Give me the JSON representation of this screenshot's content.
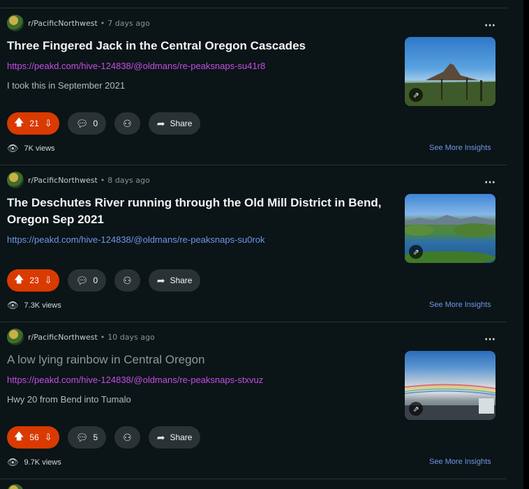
{
  "posts": [
    {
      "subreddit": "r/PacificNorthwest",
      "time": "7 days ago",
      "title": "Three Fingered Jack in the Central Oregon Cascades",
      "link": "https://peakd.com/hive-124838/@oldmans/re-peaksnaps-su41r8",
      "body": "I took this in September 2021",
      "upvotes": "21",
      "comments": "0",
      "share_label": "Share",
      "views": "7K views",
      "insights_label": "See More Insights"
    },
    {
      "subreddit": "r/PacificNorthwest",
      "time": "8 days ago",
      "title": "The Deschutes River running through the Old Mill District in Bend, Oregon Sep 2021",
      "link": "https://peakd.com/hive-124838/@oldmans/re-peaksnaps-su0rok",
      "body": "",
      "upvotes": "23",
      "comments": "0",
      "share_label": "Share",
      "views": "7.3K views",
      "insights_label": "See More Insights"
    },
    {
      "subreddit": "r/PacificNorthwest",
      "time": "10 days ago",
      "title": "A low lying rainbow in Central Oregon",
      "link": "https://peakd.com/hive-124838/@oldmans/re-peaksnaps-stxvuz",
      "body": "Hwy 20 from Bend into Tumalo",
      "upvotes": "56",
      "comments": "5",
      "share_label": "Share",
      "views": "9.7K views",
      "insights_label": "See More Insights"
    }
  ],
  "icons": {
    "more": "more-horizontal-icon",
    "upvote": "arrow-up-icon",
    "downvote": "arrow-down-icon",
    "comment": "speech-bubble-icon",
    "award": "award-icon",
    "share": "share-arrow-icon",
    "views": "eye-icon",
    "external": "external-link-icon"
  },
  "colors": {
    "background": "#0b1416",
    "vote_active": "#d93a00",
    "link_visited": "#c34ee6",
    "link_unvisited": "#6f96e8",
    "insights": "#6f96e8"
  }
}
